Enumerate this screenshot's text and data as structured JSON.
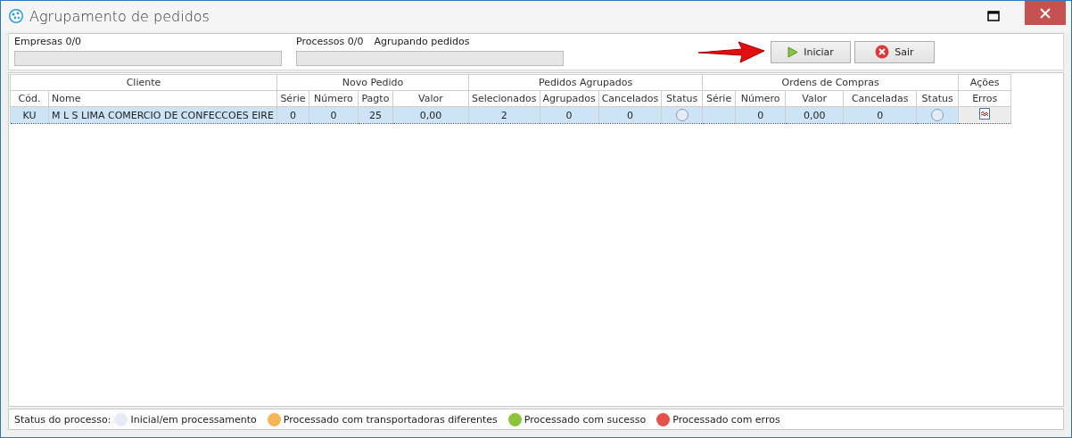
{
  "window": {
    "title": "Agrupamento de pedidos"
  },
  "progress": [
    {
      "label": "Empresas 0/0",
      "level": 0
    },
    {
      "label": "Processos 0/0",
      "status": "Agrupando pedidos",
      "level": 0
    }
  ],
  "buttons": [
    {
      "kind": "start",
      "label": "Iniciar"
    },
    {
      "kind": "exit",
      "label": "Sair"
    }
  ],
  "table": {
    "groups": [
      {
        "label": "Cliente",
        "columns": [
          "Cód.",
          "Nome"
        ]
      },
      {
        "label": "Novo Pedido",
        "columns": [
          "Série",
          "Número",
          "Pagto",
          "Valor"
        ]
      },
      {
        "label": "Pedidos Agrupados",
        "columns": [
          "Selecionados",
          "Agrupados",
          "Cancelados",
          "Status"
        ]
      },
      {
        "label": "Ordens de Compras",
        "columns": [
          "Série",
          "Número",
          "Valor",
          "Canceladas",
          "Status"
        ]
      },
      {
        "label": "Ações",
        "columns": [
          "Erros"
        ]
      }
    ],
    "rows": [
      {
        "selected": true,
        "cells": [
          {
            "kind": "text",
            "text": "KU"
          },
          {
            "kind": "text",
            "text": "M L S LIMA COMERCIO DE CONFECCOES EIRE"
          },
          {
            "kind": "text",
            "text": "0"
          },
          {
            "kind": "text",
            "text": "0"
          },
          {
            "kind": "text",
            "text": "25"
          },
          {
            "kind": "text",
            "text": "0,00"
          },
          {
            "kind": "text",
            "text": "2"
          },
          {
            "kind": "text",
            "text": "0"
          },
          {
            "kind": "text",
            "text": "0"
          },
          {
            "kind": "status",
            "color": "#e6ecf6"
          },
          {
            "kind": "empty"
          },
          {
            "kind": "text",
            "text": "0"
          },
          {
            "kind": "text",
            "text": "0,00"
          },
          {
            "kind": "text",
            "text": "0"
          },
          {
            "kind": "status",
            "color": "#e6ecf6"
          },
          {
            "kind": "action"
          }
        ]
      }
    ]
  },
  "legend": {
    "label": "Status do processo:",
    "items": [
      {
        "label": "Inicial/em processamento",
        "color": "#e6ecf6"
      },
      {
        "label": "Processado com transportadoras diferentes",
        "color": "#f3b556"
      },
      {
        "label": "Processado com sucesso",
        "color": "#8cc43c"
      },
      {
        "label": "Processado com erros",
        "color": "#e4534b"
      }
    ]
  }
}
